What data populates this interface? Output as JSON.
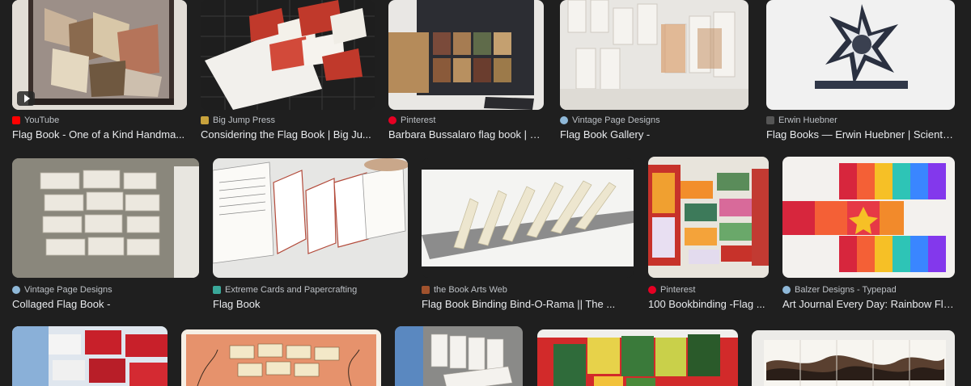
{
  "results": [
    {
      "source": "YouTube",
      "title": "Flag Book - One of a Kind Handma...",
      "favicon_color": "#ff0000",
      "has_play": true
    },
    {
      "source": "Big Jump Press",
      "title": "Considering the Flag Book | Big Ju...",
      "favicon_color": "#c8a23c"
    },
    {
      "source": "Pinterest",
      "title": "Barbara Bussalaro flag book | B...",
      "favicon_color": "#e60023"
    },
    {
      "source": "Vintage Page Designs",
      "title": "Flag Book Gallery -",
      "favicon_color": "#8fb8d8"
    },
    {
      "source": "Erwin Huebner",
      "title": "Flag Books — Erwin Huebner | Scientist ...",
      "favicon_color": "#555555"
    },
    {
      "source": "Vintage Page Designs",
      "title": "Collaged Flag Book -",
      "favicon_color": "#8fb8d8"
    },
    {
      "source": "Extreme Cards and Papercrafting",
      "title": "Flag Book",
      "favicon_color": "#3aa89a"
    },
    {
      "source": "the Book Arts Web",
      "title": "Flag Book Binding Bind-O-Rama || The ...",
      "favicon_color": "#a0522d"
    },
    {
      "source": "Pinterest",
      "title": "100 Bookbinding -Flag ...",
      "favicon_color": "#e60023"
    },
    {
      "source": "Balzer Designs - Typepad",
      "title": "Art Journal Every Day: Rainbow Fla...",
      "favicon_color": "#8fb8d8"
    }
  ]
}
